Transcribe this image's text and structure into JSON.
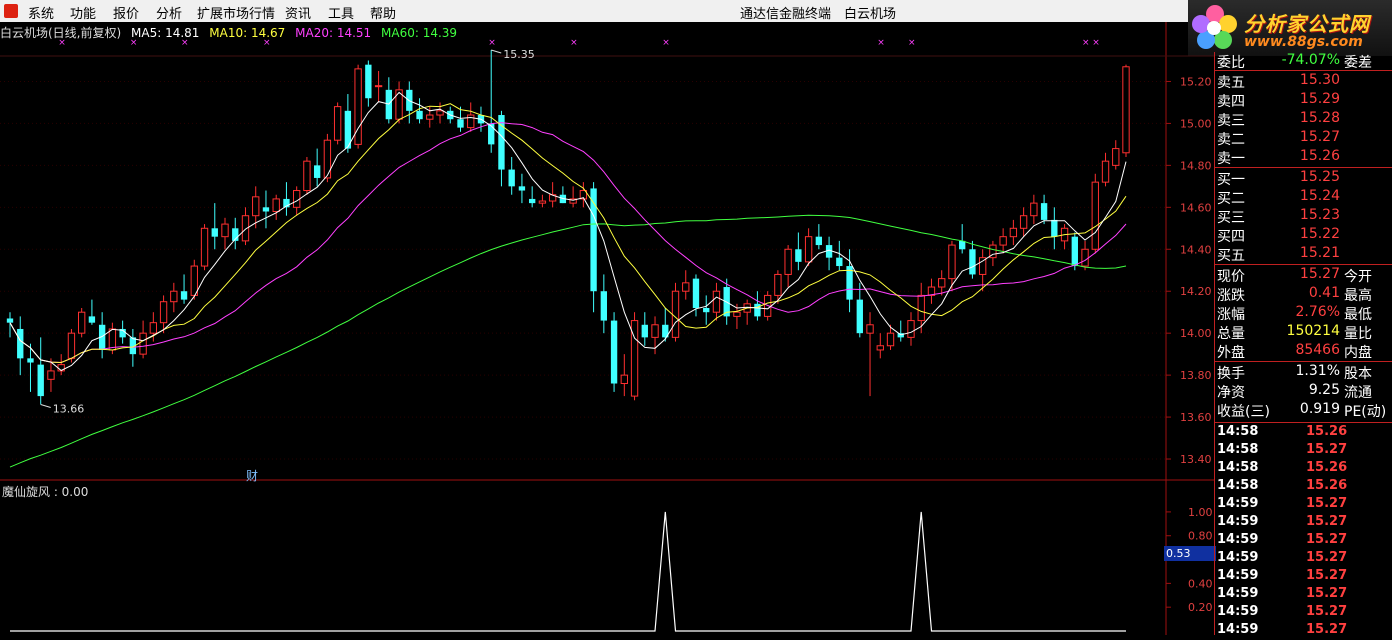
{
  "menu": {
    "items": [
      "系统",
      "功能",
      "报价",
      "分析",
      "扩展市场行情",
      "资讯",
      "工具",
      "帮助"
    ],
    "center_title": "通达信金融终端　白云机场"
  },
  "brand": {
    "name": "分析家公式网",
    "url": "www.88gs.com"
  },
  "chart_header": {
    "title": "白云机场(日线,前复权)",
    "ma5": "MA5: 14.81",
    "ma10": "MA10: 14.67",
    "ma20": "MA20: 14.51",
    "ma60": "MA60: 14.39"
  },
  "colors": {
    "ma5": "#ffffff",
    "ma10": "#ffff40",
    "ma20": "#ff40ff",
    "ma60": "#40ff40",
    "up": "#ff3030",
    "down": "#40ffff",
    "grid": "#800000"
  },
  "annotations": {
    "high": "15.35",
    "low": "13.66",
    "fin_marker": "财"
  },
  "sub_indicator": {
    "title": "魔仙旋风 : 0.00",
    "current": "0.53"
  },
  "chart_data": [
    {
      "type": "candlestick",
      "title": "白云机场(日线,前复权)",
      "ylim": [
        13.3,
        15.35
      ],
      "yticks": [
        "15.20",
        "15.00",
        "14.80",
        "14.60",
        "14.40",
        "14.20",
        "14.00",
        "13.80",
        "13.60",
        "13.40"
      ],
      "ohlc": [
        [
          14.07,
          14.1,
          13.98,
          14.05
        ],
        [
          14.02,
          14.08,
          13.8,
          13.88
        ],
        [
          13.88,
          13.95,
          13.72,
          13.86
        ],
        [
          13.85,
          13.98,
          13.66,
          13.7
        ],
        [
          13.78,
          13.88,
          13.72,
          13.82
        ],
        [
          13.82,
          13.9,
          13.8,
          13.85
        ],
        [
          13.88,
          14.02,
          13.86,
          14.0
        ],
        [
          14.0,
          14.12,
          13.98,
          14.1
        ],
        [
          14.08,
          14.16,
          14.04,
          14.05
        ],
        [
          14.04,
          14.1,
          13.88,
          13.92
        ],
        [
          13.92,
          14.05,
          13.9,
          14.02
        ],
        [
          14.02,
          14.06,
          13.95,
          13.98
        ],
        [
          13.98,
          14.02,
          13.84,
          13.9
        ],
        [
          13.9,
          14.06,
          13.88,
          14.0
        ],
        [
          14.0,
          14.1,
          13.96,
          14.05
        ],
        [
          14.05,
          14.18,
          14.0,
          14.15
        ],
        [
          14.15,
          14.24,
          14.1,
          14.2
        ],
        [
          14.2,
          14.28,
          14.14,
          14.16
        ],
        [
          14.18,
          14.35,
          14.16,
          14.32
        ],
        [
          14.32,
          14.52,
          14.3,
          14.5
        ],
        [
          14.5,
          14.62,
          14.4,
          14.46
        ],
        [
          14.46,
          14.55,
          14.4,
          14.52
        ],
        [
          14.5,
          14.55,
          14.4,
          14.44
        ],
        [
          14.44,
          14.6,
          14.42,
          14.56
        ],
        [
          14.56,
          14.7,
          14.5,
          14.65
        ],
        [
          14.6,
          14.68,
          14.5,
          14.58
        ],
        [
          14.58,
          14.66,
          14.54,
          14.64
        ],
        [
          14.64,
          14.72,
          14.56,
          14.6
        ],
        [
          14.6,
          14.7,
          14.56,
          14.68
        ],
        [
          14.68,
          14.84,
          14.66,
          14.82
        ],
        [
          14.8,
          14.88,
          14.7,
          14.74
        ],
        [
          14.74,
          14.95,
          14.72,
          14.92
        ],
        [
          14.92,
          15.1,
          14.9,
          15.08
        ],
        [
          15.06,
          15.14,
          14.86,
          14.88
        ],
        [
          14.9,
          15.28,
          14.88,
          15.26
        ],
        [
          15.28,
          15.3,
          15.08,
          15.12
        ],
        [
          15.18,
          15.25,
          15.1,
          15.18
        ],
        [
          15.16,
          15.22,
          15.0,
          15.02
        ],
        [
          15.02,
          15.2,
          15.0,
          15.16
        ],
        [
          15.16,
          15.2,
          15.0,
          15.06
        ],
        [
          15.06,
          15.12,
          15.0,
          15.02
        ],
        [
          15.02,
          15.08,
          14.98,
          15.04
        ],
        [
          15.04,
          15.1,
          15.0,
          15.06
        ],
        [
          15.06,
          15.08,
          15.0,
          15.02
        ],
        [
          15.02,
          15.08,
          14.96,
          14.98
        ],
        [
          14.98,
          15.1,
          14.96,
          15.04
        ],
        [
          15.04,
          15.08,
          14.96,
          15.0
        ],
        [
          15.0,
          15.35,
          14.86,
          14.9
        ],
        [
          15.04,
          15.06,
          14.7,
          14.78
        ],
        [
          14.78,
          14.84,
          14.66,
          14.7
        ],
        [
          14.7,
          14.76,
          14.62,
          14.68
        ],
        [
          14.64,
          14.7,
          14.6,
          14.62
        ],
        [
          14.62,
          14.66,
          14.6,
          14.63
        ],
        [
          14.63,
          14.72,
          14.6,
          14.66
        ],
        [
          14.66,
          14.7,
          14.62,
          14.62
        ],
        [
          14.62,
          14.7,
          14.6,
          14.64
        ],
        [
          14.64,
          14.72,
          14.6,
          14.68
        ],
        [
          14.69,
          14.72,
          14.1,
          14.2
        ],
        [
          14.2,
          14.28,
          14.0,
          14.06
        ],
        [
          14.06,
          14.1,
          13.72,
          13.76
        ],
        [
          13.76,
          13.9,
          13.7,
          13.8
        ],
        [
          13.7,
          14.1,
          13.68,
          14.06
        ],
        [
          14.04,
          14.1,
          13.94,
          13.98
        ],
        [
          13.98,
          14.08,
          13.9,
          14.04
        ],
        [
          14.04,
          14.12,
          13.96,
          13.98
        ],
        [
          13.98,
          14.24,
          13.96,
          14.2
        ],
        [
          14.2,
          14.3,
          14.16,
          14.24
        ],
        [
          14.26,
          14.28,
          14.08,
          14.12
        ],
        [
          14.12,
          14.18,
          14.04,
          14.1
        ],
        [
          14.1,
          14.24,
          14.06,
          14.2
        ],
        [
          14.22,
          14.26,
          14.04,
          14.08
        ],
        [
          14.08,
          14.14,
          14.02,
          14.1
        ],
        [
          14.1,
          14.16,
          14.04,
          14.14
        ],
        [
          14.14,
          14.2,
          14.06,
          14.08
        ],
        [
          14.08,
          14.2,
          14.06,
          14.18
        ],
        [
          14.18,
          14.3,
          14.14,
          14.28
        ],
        [
          14.28,
          14.42,
          14.22,
          14.4
        ],
        [
          14.4,
          14.48,
          14.3,
          14.34
        ],
        [
          14.34,
          14.5,
          14.32,
          14.46
        ],
        [
          14.46,
          14.52,
          14.4,
          14.42
        ],
        [
          14.42,
          14.46,
          14.3,
          14.36
        ],
        [
          14.36,
          14.44,
          14.3,
          14.32
        ],
        [
          14.32,
          14.4,
          14.1,
          14.16
        ],
        [
          14.16,
          14.24,
          13.98,
          14.0
        ],
        [
          14.0,
          14.1,
          13.7,
          14.04
        ],
        [
          13.92,
          14.0,
          13.88,
          13.94
        ],
        [
          13.94,
          14.04,
          13.92,
          14.0
        ],
        [
          14.0,
          14.06,
          13.96,
          13.98
        ],
        [
          13.98,
          14.1,
          13.94,
          14.06
        ],
        [
          14.06,
          14.24,
          14.0,
          14.18
        ],
        [
          14.18,
          14.26,
          14.14,
          14.22
        ],
        [
          14.22,
          14.3,
          14.18,
          14.26
        ],
        [
          14.26,
          14.44,
          14.2,
          14.42
        ],
        [
          14.44,
          14.52,
          14.38,
          14.4
        ],
        [
          14.4,
          14.44,
          14.26,
          14.28
        ],
        [
          14.28,
          14.4,
          14.2,
          14.36
        ],
        [
          14.36,
          14.44,
          14.32,
          14.42
        ],
        [
          14.42,
          14.5,
          14.38,
          14.46
        ],
        [
          14.46,
          14.54,
          14.42,
          14.5
        ],
        [
          14.5,
          14.6,
          14.46,
          14.56
        ],
        [
          14.56,
          14.66,
          14.52,
          14.62
        ],
        [
          14.62,
          14.66,
          14.52,
          14.54
        ],
        [
          14.54,
          14.6,
          14.4,
          14.46
        ],
        [
          14.44,
          14.52,
          14.4,
          14.5
        ],
        [
          14.46,
          14.48,
          14.3,
          14.32
        ],
        [
          14.32,
          14.44,
          14.3,
          14.4
        ],
        [
          14.4,
          14.76,
          14.38,
          14.72
        ],
        [
          14.72,
          14.86,
          14.7,
          14.82
        ],
        [
          14.8,
          14.92,
          14.78,
          14.88
        ],
        [
          14.86,
          15.28,
          14.84,
          15.27
        ]
      ]
    },
    {
      "type": "line",
      "title": "魔仙旋风",
      "ylim": [
        0,
        1.1
      ],
      "yticks": [
        "1.00",
        "0.80",
        "0.40",
        "0.20"
      ],
      "spikes": [
        {
          "index": 64,
          "value": 1.0
        },
        {
          "index": 89,
          "value": 1.0
        }
      ]
    }
  ],
  "quote_panel": {
    "ratio_row": {
      "label": "委比",
      "value": "-74.07%",
      "label2": "委差"
    },
    "sells": [
      {
        "label": "卖五",
        "price": "15.30"
      },
      {
        "label": "卖四",
        "price": "15.29"
      },
      {
        "label": "卖三",
        "price": "15.28"
      },
      {
        "label": "卖二",
        "price": "15.27"
      },
      {
        "label": "卖一",
        "price": "15.26"
      }
    ],
    "buys": [
      {
        "label": "买一",
        "price": "15.25"
      },
      {
        "label": "买二",
        "price": "15.24"
      },
      {
        "label": "买三",
        "price": "15.23"
      },
      {
        "label": "买四",
        "price": "15.22"
      },
      {
        "label": "买五",
        "price": "15.21"
      }
    ],
    "stats": [
      {
        "label": "现价",
        "value": "15.27",
        "label2": "今开",
        "color": "#ff4040"
      },
      {
        "label": "涨跌",
        "value": "0.41",
        "label2": "最高",
        "color": "#ff4040"
      },
      {
        "label": "涨幅",
        "value": "2.76%",
        "label2": "最低",
        "color": "#ff4040"
      },
      {
        "label": "总量",
        "value": "150214",
        "label2": "量比",
        "color": "#ffff40"
      },
      {
        "label": "外盘",
        "value": "85466",
        "label2": "内盘",
        "color": "#ff4040"
      }
    ],
    "stats2": [
      {
        "label": "换手",
        "value": "1.31%",
        "label2": "股本"
      },
      {
        "label": "净资",
        "value": "9.25",
        "label2": "流通"
      },
      {
        "label": "收益(三)",
        "value": "0.919",
        "label2": "PE(动)"
      }
    ]
  },
  "ticks": [
    {
      "time": "14:58",
      "price": "15.26"
    },
    {
      "time": "14:58",
      "price": "15.27"
    },
    {
      "time": "14:58",
      "price": "15.26"
    },
    {
      "time": "14:58",
      "price": "15.26"
    },
    {
      "time": "14:59",
      "price": "15.27"
    },
    {
      "time": "14:59",
      "price": "15.27"
    },
    {
      "time": "14:59",
      "price": "15.27"
    },
    {
      "time": "14:59",
      "price": "15.27"
    },
    {
      "time": "14:59",
      "price": "15.27"
    },
    {
      "time": "14:59",
      "price": "15.27"
    },
    {
      "time": "14:59",
      "price": "15.27"
    },
    {
      "time": "14:59",
      "price": "15.27"
    }
  ]
}
